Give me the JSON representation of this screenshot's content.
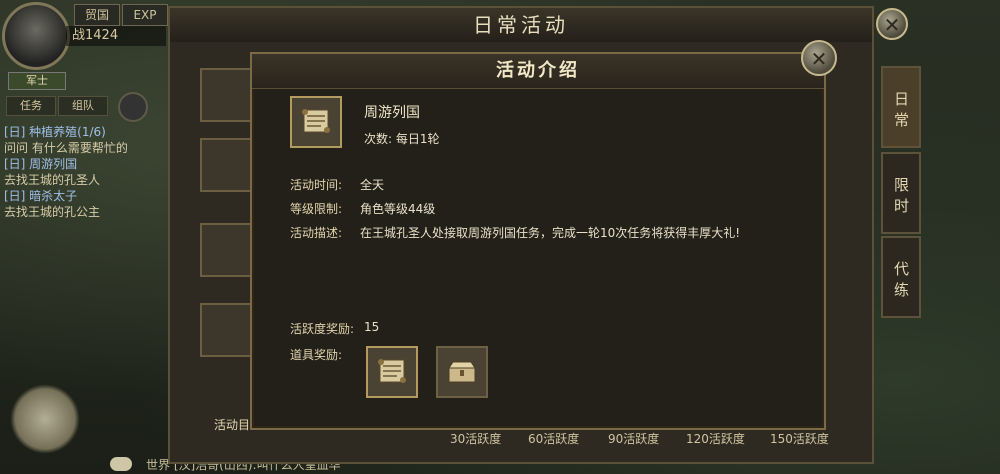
{
  "hud": {
    "top_buttons": [
      "贸国",
      "EXP"
    ],
    "power": "战1424",
    "rank": "军士",
    "tabs": [
      "任务",
      "组队"
    ],
    "tasks": [
      {
        "head": "[日] 种植养殖(1/6)",
        "body": "问问 有什么需要帮忙的"
      },
      {
        "head": "[日] 周游列国",
        "body": "去找王城的孔圣人"
      },
      {
        "head": "[日] 暗杀太子",
        "body": "去找王城的孔公主"
      }
    ],
    "chat": "世界 [汉]浩哥(山西):叫什么人皇血华"
  },
  "daily_window": {
    "title": "日常活动",
    "side_tabs": [
      "日常",
      "限时",
      "代练"
    ],
    "bottom_activity": [
      "30活跃度",
      "60活跃度",
      "90活跃度",
      "120活跃度",
      "150活跃度"
    ],
    "bottom_left_label": "活动目"
  },
  "intro_panel": {
    "title": "活动介绍",
    "item_name": "周游列国",
    "times": "次数: 每日1轮",
    "rows": [
      {
        "label": "活动时间:",
        "value": "全天"
      },
      {
        "label": "等级限制:",
        "value": "角色等级44级"
      },
      {
        "label": "活动描述:",
        "value": "在王城孔圣人处接取周游列国任务，完成一轮10次任务将获得丰厚大礼!"
      }
    ],
    "activity_label": "活跃度奖励:",
    "activity_value": "15",
    "reward_label": "道具奖励:",
    "reward_icons": [
      "scroll-icon",
      "chest-icon"
    ]
  },
  "colors": {
    "accent": "#b39a5e",
    "panel": "#231f19",
    "title_text": "#f2e8c8"
  }
}
